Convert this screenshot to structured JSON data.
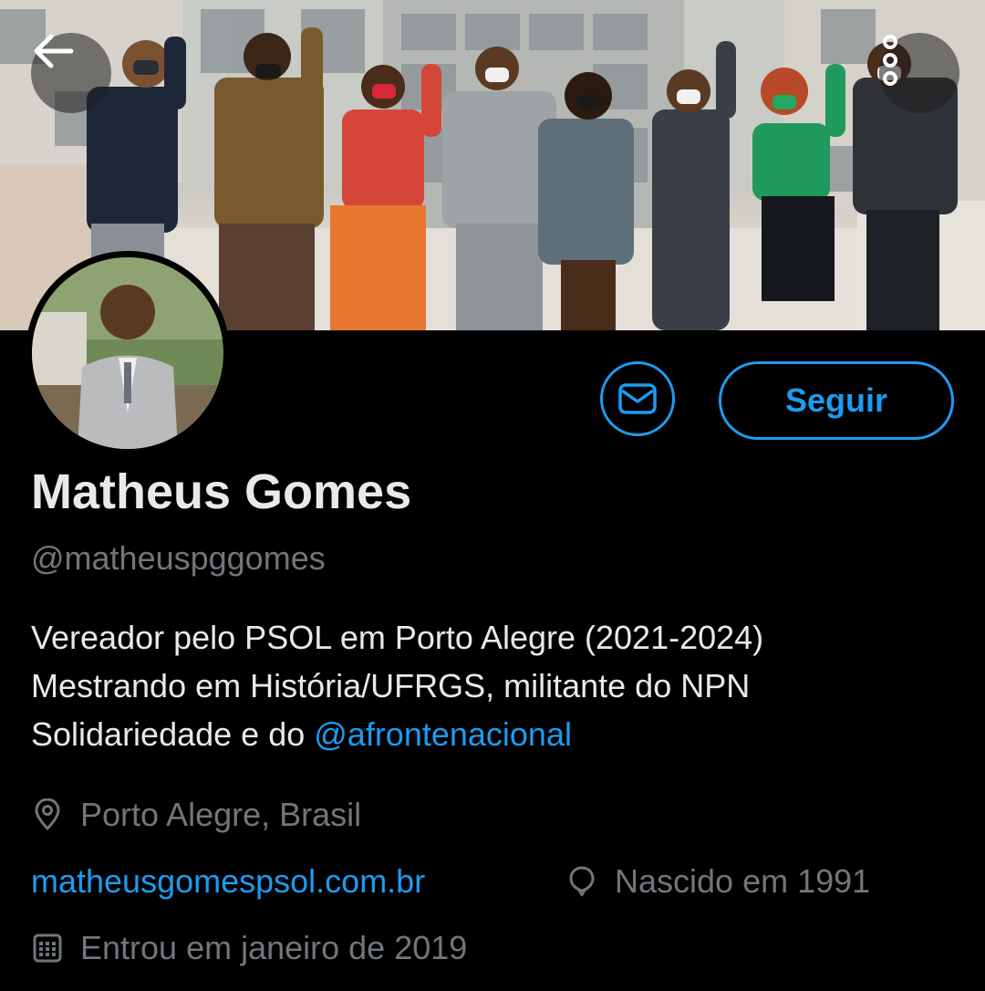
{
  "profile": {
    "display_name": "Matheus Gomes",
    "handle": "@matheuspggomes",
    "bio": {
      "line1": "Vereador pelo PSOL em Porto Alegre (2021-2024)",
      "line2": "Mestrando em História/UFRGS, militante do NPN",
      "line3_prefix": "Solidariedade e do ",
      "line3_mention": "@afrontenacional"
    },
    "location": "Porto Alegre, Brasil",
    "website": "matheusgomespsol.com.br",
    "birth": "Nascido em 1991",
    "joined": "Entrou em janeiro de 2019"
  },
  "actions": {
    "follow_label": "Seguir"
  },
  "icons": {
    "back": "arrow-left-icon",
    "more": "more-vertical-icon",
    "message": "envelope-icon",
    "location": "location-pin-icon",
    "birth": "balloon-icon",
    "calendar": "calendar-icon"
  },
  "colors": {
    "background": "#000000",
    "accent": "#1d9bf0",
    "primary_text": "#e7e9ea",
    "secondary_text": "#71767b"
  }
}
